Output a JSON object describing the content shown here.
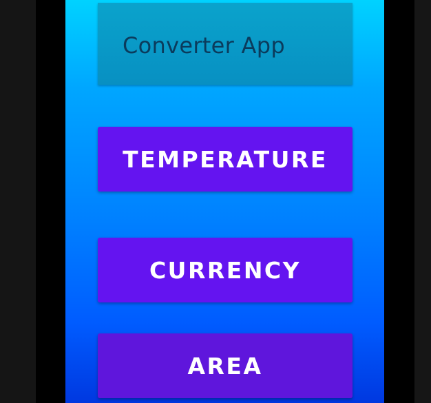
{
  "app": {
    "title": "Converter App"
  },
  "buttons": {
    "temperature_label": "TEMPERATURE",
    "currency_label": "CURRENCY",
    "area_label": "AREA"
  },
  "colors": {
    "button_background": "#6414f0",
    "title_bar_background": "#0a9dca",
    "title_text": "#0b3b5c",
    "screen_gradient_top": "#00d2ff",
    "screen_gradient_bottom": "#0038e0"
  }
}
